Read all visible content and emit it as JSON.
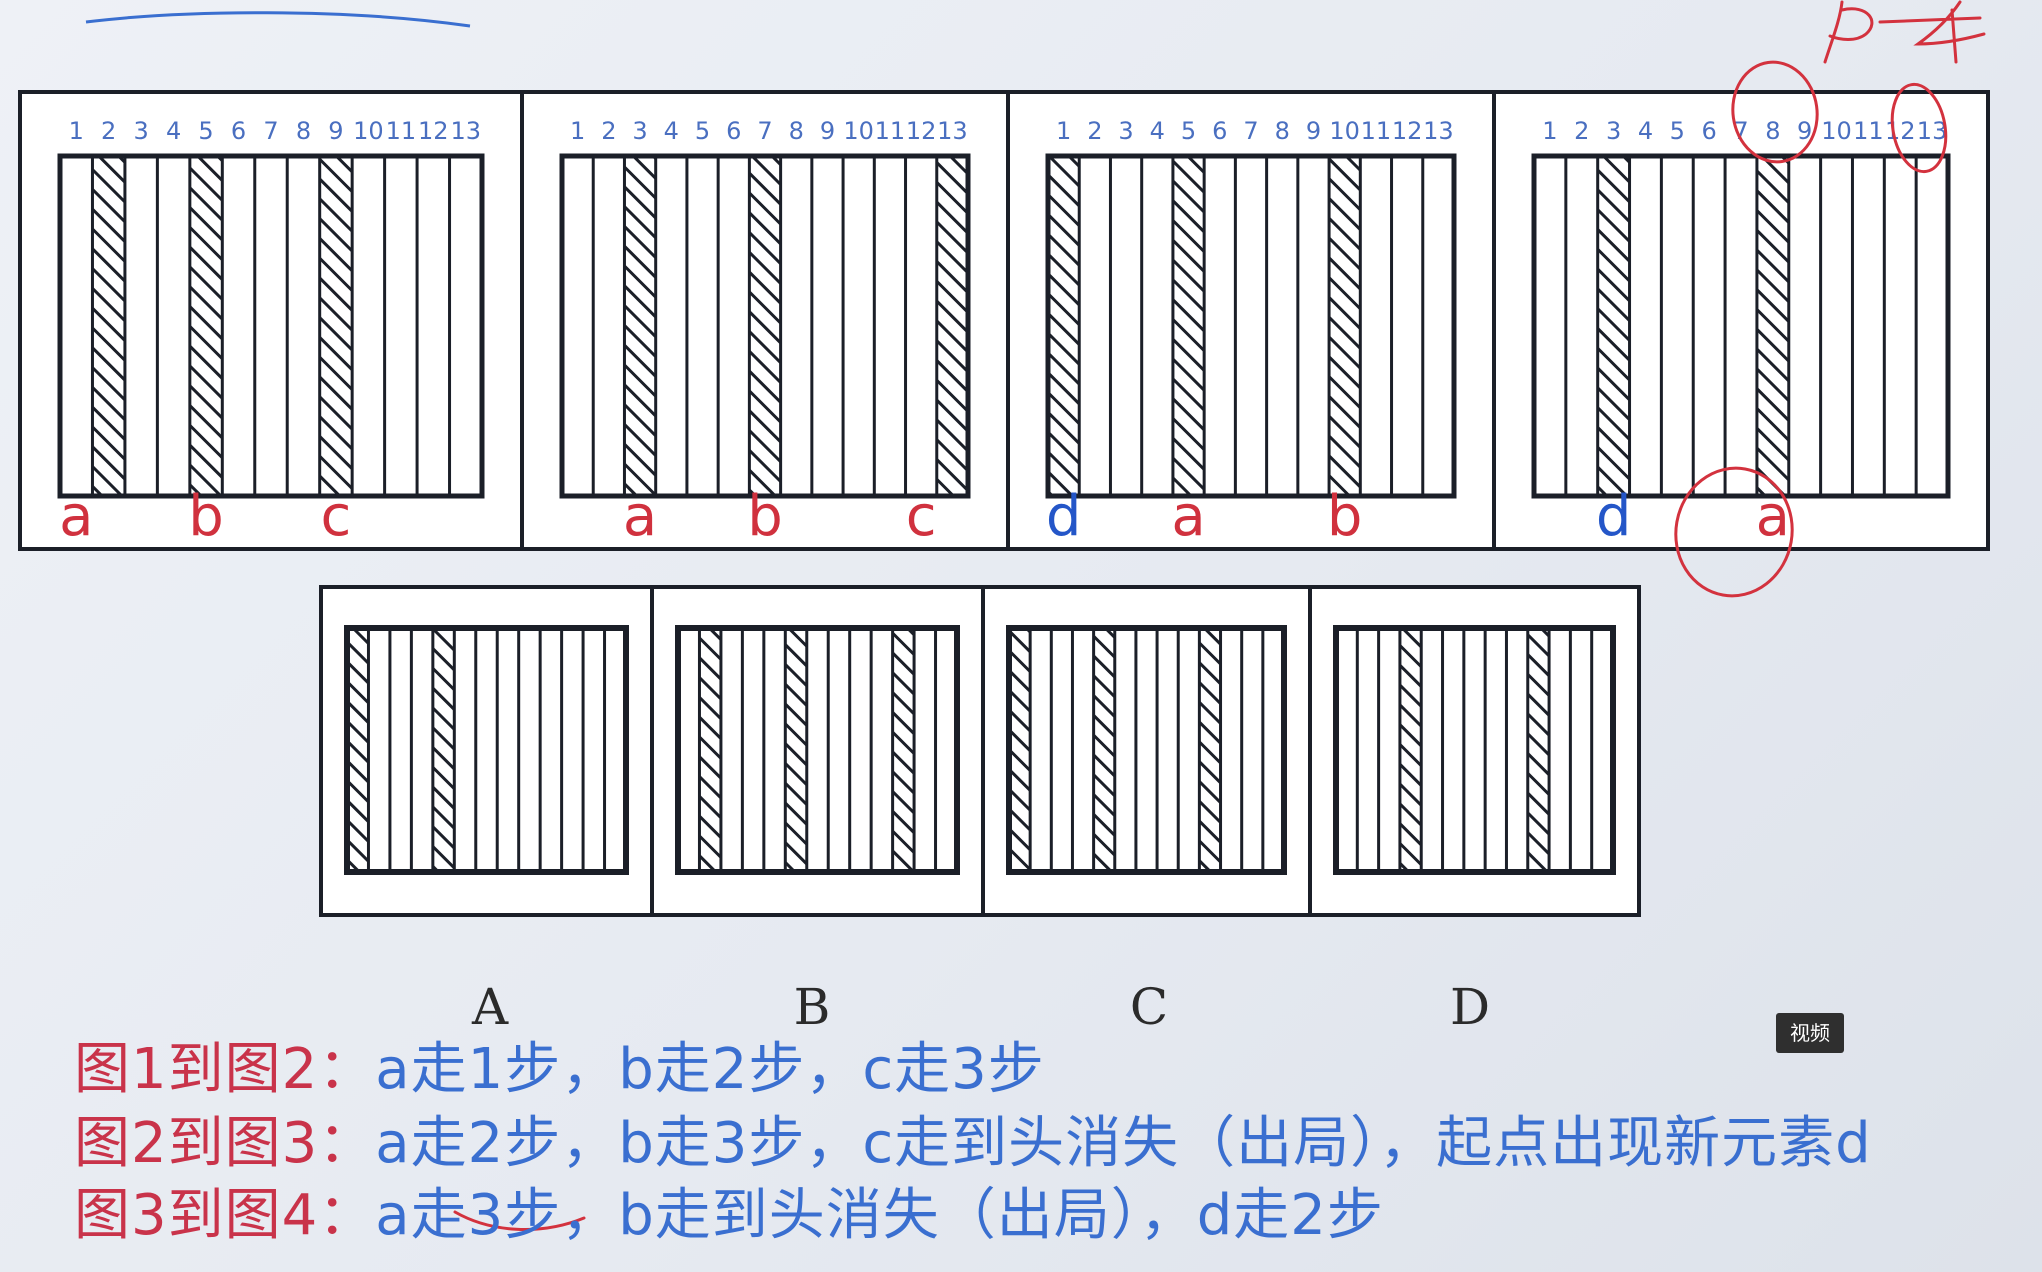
{
  "colors": {
    "line_prefix": "#c9334a",
    "line_text": "#3a6fd0",
    "label_red": "#d0313e",
    "label_blue": "#2456c8",
    "number_blue": "#4a6fc0",
    "frame": "#1b1f28"
  },
  "top_panels": [
    {
      "numbers": [
        "1",
        "2",
        "3",
        "4",
        "5",
        "6",
        "7",
        "8",
        "9",
        "10",
        "11",
        "12",
        "13"
      ],
      "hatched": [
        2,
        5,
        9
      ],
      "labels": [
        {
          "col": 1,
          "text": "a",
          "color": "red"
        },
        {
          "col": 5,
          "text": "b",
          "color": "red"
        },
        {
          "col": 9,
          "text": "c",
          "color": "red"
        }
      ]
    },
    {
      "numbers": [
        "1",
        "2",
        "3",
        "4",
        "5",
        "6",
        "7",
        "8",
        "9",
        "10",
        "11",
        "12",
        "13"
      ],
      "hatched": [
        3,
        7,
        13
      ],
      "labels": [
        {
          "col": 3,
          "text": "a",
          "color": "red"
        },
        {
          "col": 7,
          "text": "b",
          "color": "red"
        },
        {
          "col": 12,
          "text": "c",
          "color": "red"
        }
      ]
    },
    {
      "numbers": [
        "1",
        "2",
        "3",
        "4",
        "5",
        "6",
        "7",
        "8",
        "9",
        "10",
        "11",
        "12",
        "13"
      ],
      "hatched": [
        1,
        5,
        10
      ],
      "labels": [
        {
          "col": 1,
          "text": "d",
          "color": "blue"
        },
        {
          "col": 5,
          "text": "a",
          "color": "red"
        },
        {
          "col": 10,
          "text": "b",
          "color": "red"
        }
      ]
    },
    {
      "numbers": [
        "1",
        "2",
        "3",
        "4",
        "5",
        "6",
        "7",
        "8",
        "9",
        "10",
        "11",
        "12",
        "13"
      ],
      "hatched": [
        3,
        8
      ],
      "labels": [
        {
          "col": 3,
          "text": "d",
          "color": "blue"
        },
        {
          "col": 8,
          "text": "a",
          "color": "red"
        }
      ]
    }
  ],
  "option_panels": [
    {
      "caption": "A",
      "hatched": [
        1,
        5
      ]
    },
    {
      "caption": "B",
      "hatched": [
        2,
        6,
        11
      ]
    },
    {
      "caption": "C",
      "hatched": [
        1,
        5,
        10
      ]
    },
    {
      "caption": "D",
      "hatched": [
        4,
        10
      ]
    }
  ],
  "explanations": [
    {
      "prefix": "图1到图2：",
      "text": "a走1步，b走2步，c走3步"
    },
    {
      "prefix": "图2到图3：",
      "text": "a走2步，b走3步，c走到头消失（出局），起点出现新元素d"
    },
    {
      "prefix": "图3到图4：",
      "text": "a走3步，b走到头消失（出局），d走2步"
    }
  ],
  "handwriting": "P4",
  "video_badge": "视频"
}
